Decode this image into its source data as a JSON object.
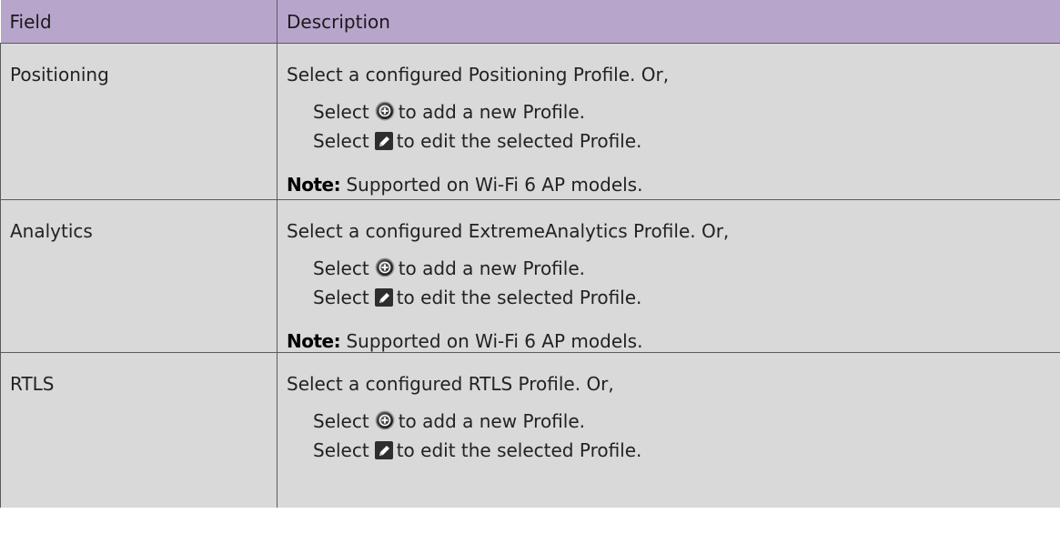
{
  "table": {
    "headers": {
      "field": "Field",
      "description": "Description"
    },
    "rows": [
      {
        "field": "Positioning",
        "intro": "Select a configured Positioning Profile. Or,",
        "add_prefix": "Select",
        "add_suffix": "to add a new Profile.",
        "edit_prefix": "Select",
        "edit_suffix": "to edit the selected Profile.",
        "note_label": "Note:",
        "note_text": " Supported on Wi-Fi 6 AP models."
      },
      {
        "field": "Analytics",
        "intro": "Select a configured ExtremeAnalytics Profile. Or,",
        "add_prefix": "Select",
        "add_suffix": "to add a new Profile.",
        "edit_prefix": "Select",
        "edit_suffix": "to edit the selected Profile.",
        "note_label": "Note:",
        "note_text": " Supported on Wi-Fi 6 AP models."
      },
      {
        "field": "RTLS",
        "intro": "Select a configured RTLS Profile. Or,",
        "add_prefix": "Select",
        "add_suffix": "to add a new Profile.",
        "edit_prefix": "Select",
        "edit_suffix": "to edit the selected Profile."
      }
    ]
  },
  "icons": {
    "add": "add-circle-icon",
    "edit": "edit-pencil-icon"
  },
  "colors": {
    "header_bg": "#b8a5cc",
    "cell_bg": "#d9d9d9",
    "border": "#5b5b5b"
  }
}
